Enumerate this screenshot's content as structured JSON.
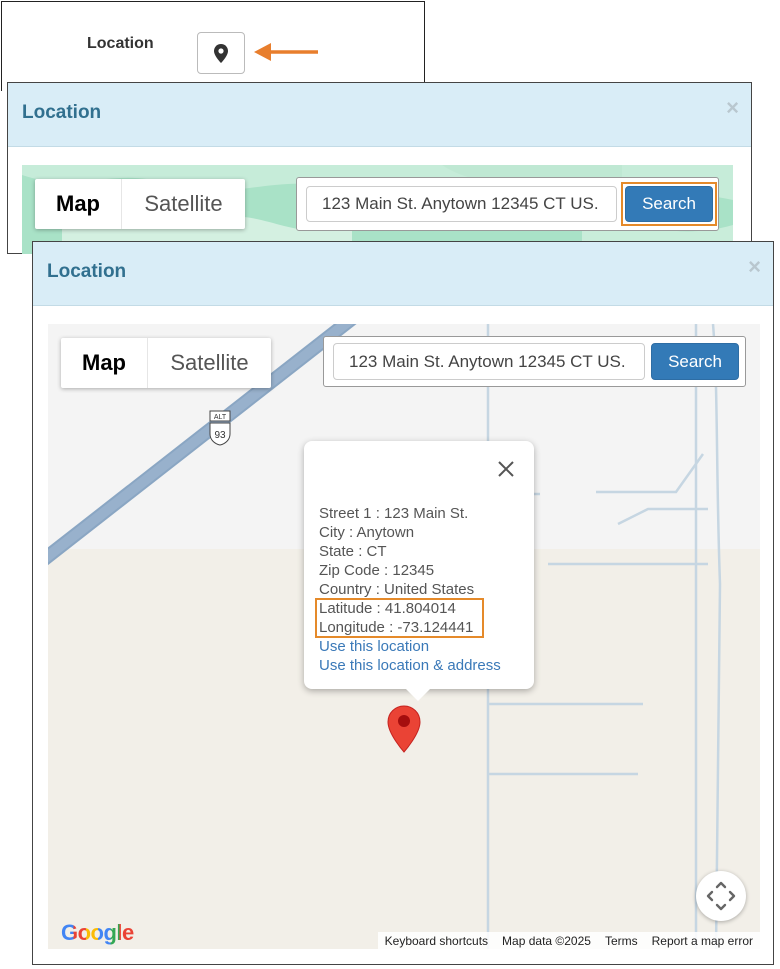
{
  "field": {
    "label": "Location",
    "button_icon": "map-pin-icon",
    "arrow_color": "#e87e2d"
  },
  "dialog_top": {
    "title": "Location",
    "close": "×",
    "map_type": {
      "map": "Map",
      "satellite": "Satellite"
    },
    "search": {
      "value": "123 Main St. Anytown 12345 CT US.",
      "button": "Search"
    }
  },
  "dialog_main": {
    "title": "Location",
    "close": "×",
    "map_type": {
      "map": "Map",
      "satellite": "Satellite"
    },
    "search": {
      "value": "123 Main St. Anytown 12345 CT US.",
      "button": "Search"
    },
    "route_shield": {
      "top": "ALT",
      "number": "93"
    },
    "popup": {
      "street": "Street 1 : 123 Main St.",
      "city": "City : Anytown",
      "state": "State : CT",
      "zip": "Zip Code : 12345",
      "country": "Country : United States",
      "latitude": "Latitude : 41.804014",
      "longitude": "Longitude : -73.124441",
      "use_location": "Use this location",
      "use_location_address": "Use this location & address"
    },
    "google_logo": "Google",
    "attribution": {
      "shortcuts": "Keyboard shortcuts",
      "map_data": "Map data ©2025",
      "terms": "Terms",
      "report": "Report a map error"
    }
  },
  "colors": {
    "header_bg": "#d9edf7",
    "title": "#31708f",
    "button": "#337ab7",
    "highlight": "#e58a2a",
    "marker": "#ea4335"
  }
}
